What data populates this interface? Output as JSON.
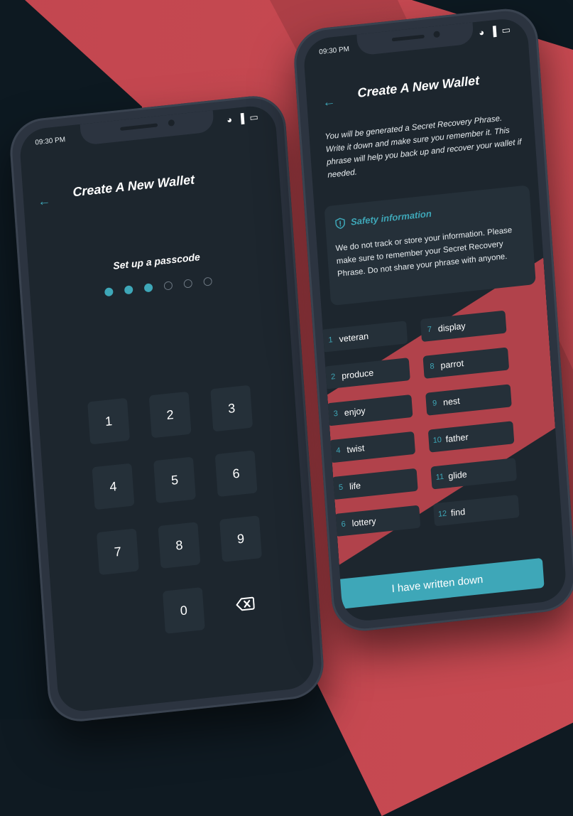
{
  "colors": {
    "accent": "#3ea7b8",
    "background_red": "#c2464f",
    "background_dark": "#0d1921",
    "screen": "#1d262e",
    "card": "#253039"
  },
  "left_phone": {
    "status_time": "09:30 PM",
    "status_icons": "wifi-icon signal-icon battery-icon",
    "title": "Create A New Wallet",
    "passcode_label": "Set up a passcode",
    "passcode_filled": 3,
    "passcode_length": 6,
    "keys": [
      "1",
      "2",
      "3",
      "4",
      "5",
      "6",
      "7",
      "8",
      "9",
      "0"
    ]
  },
  "right_phone": {
    "status_time": "09:30 PM",
    "title": "Create A New Wallet",
    "intro": "You will be generated a Secret Recovery Phrase. Write it down and make sure you remember it. This phrase will help you back up and recover your wallet if needed.",
    "safety_title": "Safety information",
    "safety_text": "We do not track or store your information. Please make sure to remember your Secret Recovery Phrase. Do not share your phrase with anyone.",
    "words": [
      {
        "n": "1",
        "w": "veteran"
      },
      {
        "n": "7",
        "w": "display"
      },
      {
        "n": "2",
        "w": "produce"
      },
      {
        "n": "8",
        "w": "parrot"
      },
      {
        "n": "3",
        "w": "enjoy"
      },
      {
        "n": "9",
        "w": "nest"
      },
      {
        "n": "4",
        "w": "twist"
      },
      {
        "n": "10",
        "w": "father"
      },
      {
        "n": "5",
        "w": "life"
      },
      {
        "n": "11",
        "w": "glide"
      },
      {
        "n": "6",
        "w": "lottery"
      },
      {
        "n": "12",
        "w": "find"
      }
    ],
    "button_label": "I have written down"
  }
}
